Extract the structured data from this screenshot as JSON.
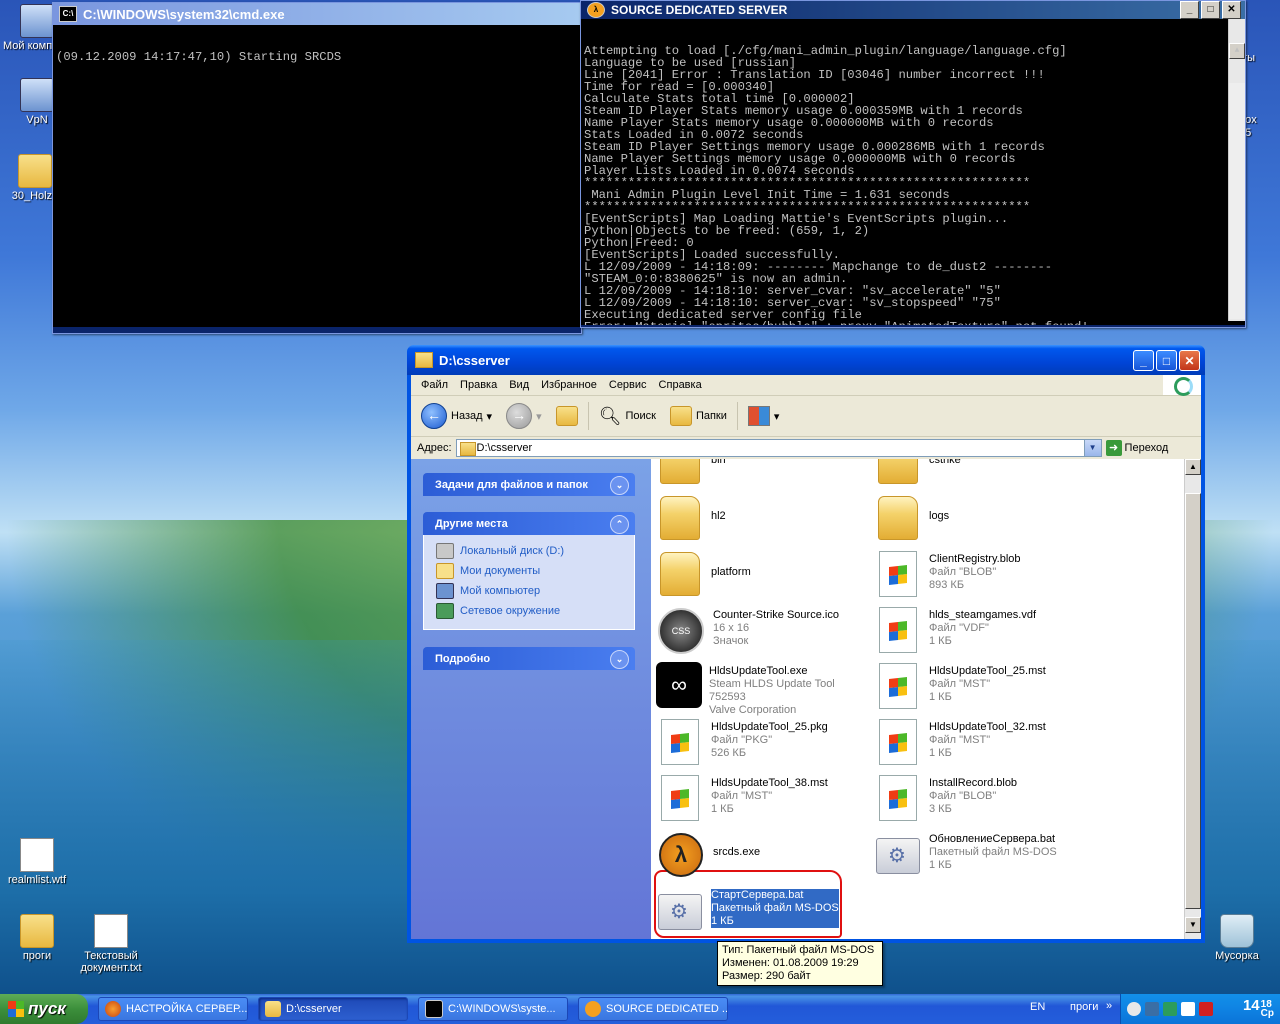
{
  "desktop": {
    "icons": [
      {
        "label": "Мой компьютер",
        "label_visible": "Мой компьют"
      },
      {
        "label": "VpN"
      },
      {
        "label": "30_Holzen",
        "label_visible": "30_Holze"
      },
      {
        "label": "realmlist.wtf"
      },
      {
        "label": "проги"
      },
      {
        "label": "Текстовый документ.txt"
      },
      {
        "label": "Корзина",
        "label_visible": "Мусорка"
      }
    ],
    "right_edge_fragments": [
      "нты",
      "efox",
      "a 5",
      "a"
    ]
  },
  "cmd_window": {
    "title": "C:\\WINDOWS\\system32\\cmd.exe",
    "lines": [
      "(09.12.2009 14:17:47,10) Starting SRCDS"
    ]
  },
  "srcds_window": {
    "title": "SOURCE DEDICATED SERVER",
    "lines": [
      "Attempting to load [./cfg/mani_admin_plugin/language/language.cfg]",
      "Language to be used [russian]",
      "Line [2041] Error : Translation ID [03046] number incorrect !!!",
      "Time for read = [0.000340]",
      "Calculate Stats total time [0.000002]",
      "Steam ID Player Stats memory usage 0.000359MB with 1 records",
      "Name Player Stats memory usage 0.000000MB with 0 records",
      "Stats Loaded in 0.0072 seconds",
      "Steam ID Player Settings memory usage 0.000286MB with 1 records",
      "Name Player Settings memory usage 0.000000MB with 0 records",
      "Player Lists Loaded in 0.0074 seconds",
      "*************************************************************",
      " Mani Admin Plugin Level Init Time = 1.631 seconds",
      "*************************************************************",
      "[EventScripts] Map Loading Mattie's EventScripts plugin...",
      "Python|Objects to be freed: (659, 1, 2)",
      "Python|Freed: 0",
      "[EventScripts] Loaded successfully.",
      "L 12/09/2009 - 14:18:09: -------- Mapchange to de_dust2 --------",
      "\"STEAM_0:0:8380625\" is now an admin.",
      "L 12/09/2009 - 14:18:10: server_cvar: \"sv_accelerate\" \"5\"",
      "L 12/09/2009 - 14:18:10: server_cvar: \"sv_stopspeed\" \"75\"",
      "Executing dedicated server config file",
      "Error: Material \"sprites/bubble\" : proxy \"AnimatedTexture\" not found!"
    ]
  },
  "explorer": {
    "title": "D:\\csserver",
    "menu": [
      "Файл",
      "Правка",
      "Вид",
      "Избранное",
      "Сервис",
      "Справка"
    ],
    "toolbar": {
      "back": "Назад",
      "search": "Поиск",
      "folders": "Папки"
    },
    "address_label": "Адрес:",
    "address_value": "D:\\csserver",
    "go_label": "Переход",
    "panels": {
      "tasks": "Задачи для файлов и папок",
      "other_places": "Другие места",
      "details": "Подробно",
      "places": [
        "Локальный диск (D:)",
        "Мои документы",
        "Мой компьютер",
        "Сетевое окружение"
      ]
    },
    "files": [
      {
        "name": "bin",
        "line2": "",
        "line3": "",
        "kind": "folder"
      },
      {
        "name": "cstrike",
        "line2": "",
        "line3": "",
        "kind": "folder"
      },
      {
        "name": "hl2",
        "line2": "",
        "line3": "",
        "kind": "folder"
      },
      {
        "name": "logs",
        "line2": "",
        "line3": "",
        "kind": "folder"
      },
      {
        "name": "platform",
        "line2": "",
        "line3": "",
        "kind": "folder"
      },
      {
        "name": "ClientRegistry.blob",
        "line2": "Файл \"BLOB\"",
        "line3": "893 КБ",
        "kind": "doc"
      },
      {
        "name": "Counter-Strike Source.ico",
        "line2": "16 x 16",
        "line3": "Значок",
        "kind": "css"
      },
      {
        "name": "hlds_steamgames.vdf",
        "line2": "Файл \"VDF\"",
        "line3": "1 КБ",
        "kind": "doc"
      },
      {
        "name": "HldsUpdateTool.exe",
        "line2": "Steam HLDS Update Tool 752593",
        "line3": "Valve Corporation",
        "kind": "steam"
      },
      {
        "name": "HldsUpdateTool_25.mst",
        "line2": "Файл \"MST\"",
        "line3": "1 КБ",
        "kind": "doc"
      },
      {
        "name": "HldsUpdateTool_25.pkg",
        "line2": "Файл \"PKG\"",
        "line3": "526 КБ",
        "kind": "doc"
      },
      {
        "name": "HldsUpdateTool_32.mst",
        "line2": "Файл \"MST\"",
        "line3": "1 КБ",
        "kind": "doc"
      },
      {
        "name": "HldsUpdateTool_38.mst",
        "line2": "Файл \"MST\"",
        "line3": "1 КБ",
        "kind": "doc"
      },
      {
        "name": "InstallRecord.blob",
        "line2": "Файл \"BLOB\"",
        "line3": "3 КБ",
        "kind": "doc"
      },
      {
        "name": "srcds.exe",
        "line2": "",
        "line3": "",
        "kind": "hl"
      },
      {
        "name": "ОбновлениеСервера.bat",
        "line2": "Пакетный файл MS-DOS",
        "line3": "1 КБ",
        "kind": "bat"
      },
      {
        "name": "СтартСервера.bat",
        "line2": "Пакетный файл MS-DOS",
        "line3": "1 КБ",
        "kind": "bat",
        "selected": true
      }
    ],
    "tooltip": {
      "type": "Тип: Пакетный файл MS-DOS",
      "modified": "Изменен: 01.08.2009 19:29",
      "size": "Размер: 290 байт"
    }
  },
  "taskbar": {
    "start_label": "пуск",
    "tasks": [
      "НАСТРОЙКА СЕРВЕР...",
      "D:\\csserver",
      "C:\\WINDOWS\\syste...",
      "SOURCE DEDICATED ..."
    ],
    "lang": "EN",
    "folder": "проги",
    "time_h": "14",
    "time_m": "18",
    "day": "Ср"
  }
}
